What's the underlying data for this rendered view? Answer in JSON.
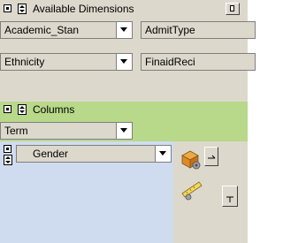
{
  "available_dimensions": {
    "title": "Available Dimensions",
    "items": [
      "Academic_Stan",
      "AdmitType",
      "Ethnicity",
      "FinaidReci"
    ]
  },
  "columns": {
    "title": "Columns",
    "items": [
      "Term"
    ]
  },
  "rows": {
    "items": [
      "Gender"
    ]
  },
  "colors": {
    "sidebar_bg": "#dcd8cc",
    "section_bg": "#b8d88a",
    "rows_bg": "#cfdcf0"
  }
}
